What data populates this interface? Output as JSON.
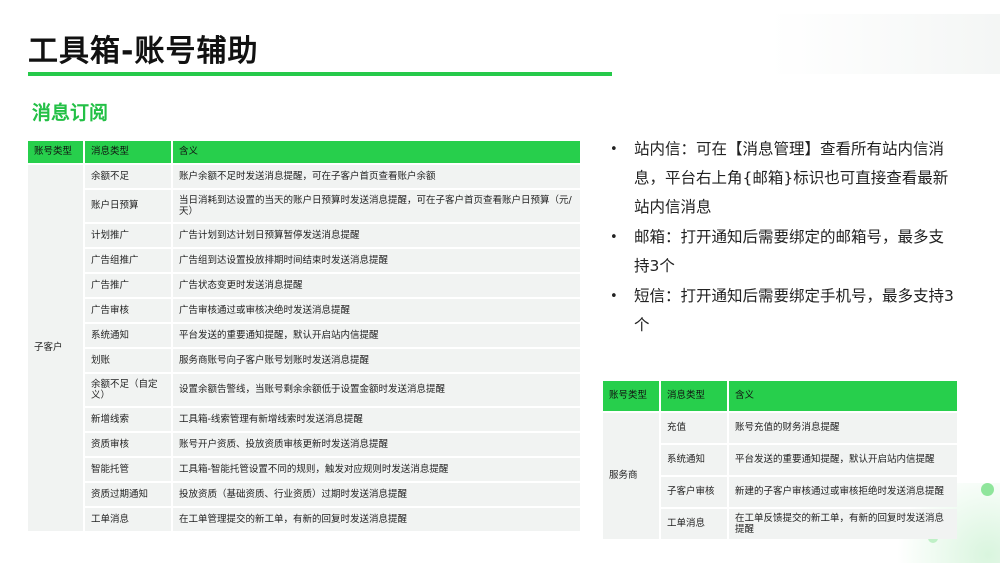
{
  "title": "工具箱-账号辅助",
  "subtitle": "消息订阅",
  "sub_table": {
    "headers": [
      "账号类型",
      "消息类型",
      "含义"
    ],
    "account_type": "子客户",
    "rows": [
      {
        "type": "余额不足",
        "meaning": "账户余额不足时发送消息提醒，可在子客户首页查看账户余额"
      },
      {
        "type": "账户日预算",
        "meaning": "当日消耗到达设置的当天的账户日预算时发送消息提醒，可在子客户首页查看账户日预算（元/天）"
      },
      {
        "type": "计划推广",
        "meaning": "广告计划到达计划日预算暂停发送消息提醒"
      },
      {
        "type": "广告组推广",
        "meaning": "广告组到达设置投放排期时间结束时发送消息提醒"
      },
      {
        "type": "广告推广",
        "meaning": "广告状态变更时发送消息提醒"
      },
      {
        "type": "广告审核",
        "meaning": "广告审核通过或审核决绝时发送消息提醒"
      },
      {
        "type": "系统通知",
        "meaning": "平台发送的重要通知提醒，默认开启站内信提醒"
      },
      {
        "type": "划账",
        "meaning": "服务商账号向子客户账号划账时发送消息提醒"
      },
      {
        "type": "余额不足（自定义）",
        "meaning": "设置余额告警线，当账号剩余余额低于设置金额时发送消息提醒"
      },
      {
        "type": "新增线索",
        "meaning": "工具箱-线索管理有新增线索时发送消息提醒"
      },
      {
        "type": "资质审核",
        "meaning": "账号开户资质、投放资质审核更新时发送消息提醒"
      },
      {
        "type": "智能托管",
        "meaning": "工具箱-智能托管设置不同的规则，触发对应规则时发送消息提醒"
      },
      {
        "type": "资质过期通知",
        "meaning": "投放资质（基础资质、行业资质）过期时发送消息提醒"
      },
      {
        "type": "工单消息",
        "meaning": "在工单管理提交的新工单，有新的回复时发送消息提醒"
      }
    ]
  },
  "notes": [
    "站内信：可在【消息管理】查看所有站内信消息，平台右上角{邮箱}标识也可直接查看最新站内信消息",
    "邮箱：打开通知后需要绑定的邮箱号，最多支持3个",
    "短信：打开通知后需要绑定手机号，最多支持3个"
  ],
  "bullet_char": "•",
  "svc_table": {
    "headers": [
      "账号类型",
      "消息类型",
      "含义"
    ],
    "account_type": "服务商",
    "rows": [
      {
        "type": "充值",
        "meaning": "账号充值的财务消息提醒"
      },
      {
        "type": "系统通知",
        "meaning": "平台发送的重要通知提醒，默认开启站内信提醒"
      },
      {
        "type": "子客户审核",
        "meaning": "新建的子客户审核通过或审核拒绝时发送消息提醒"
      },
      {
        "type": "工单消息",
        "meaning": "在工单反馈提交的新工单，有新的回复时发送消息提醒"
      }
    ]
  },
  "colors": {
    "accent": "#27cf4c",
    "cell_bg": "#f1f3f2",
    "subtitle": "#23c046"
  }
}
